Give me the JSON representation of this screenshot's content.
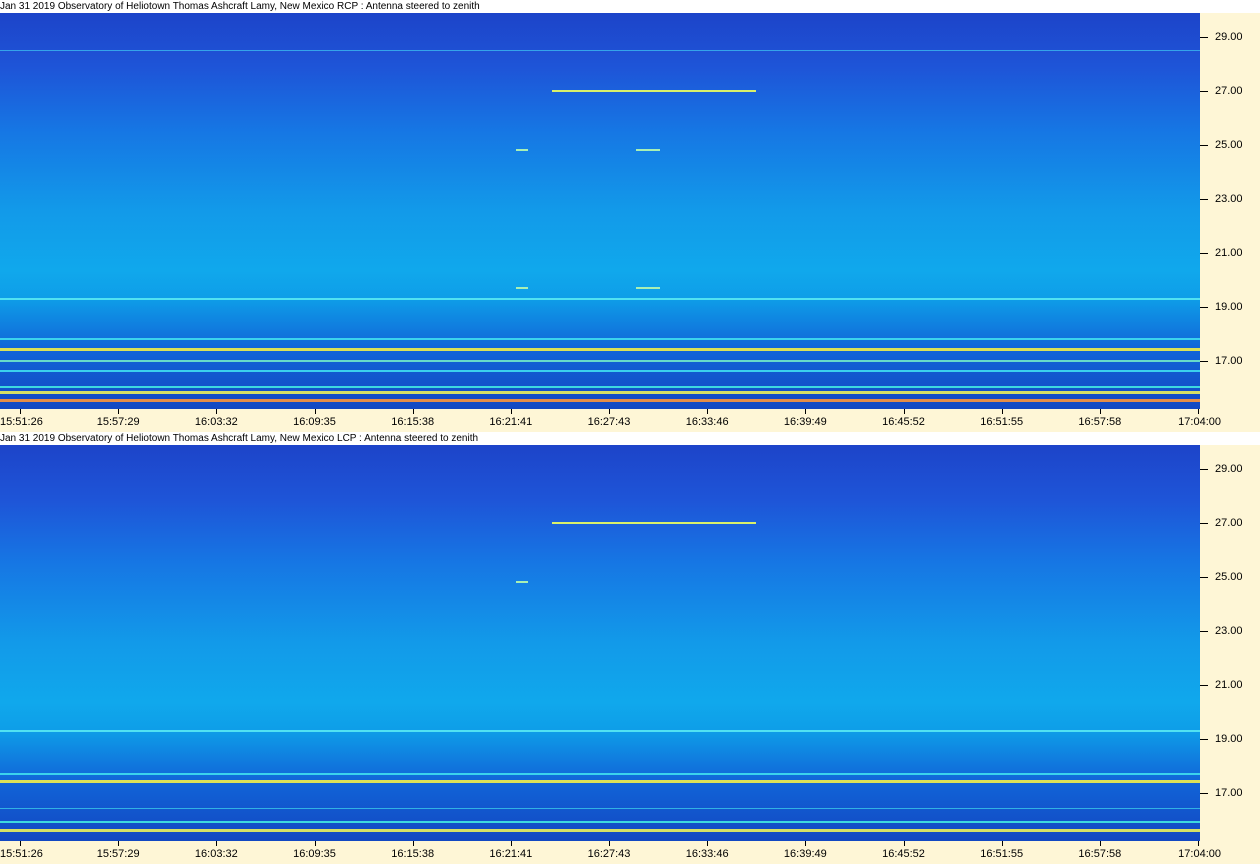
{
  "chart_data": [
    {
      "type": "heatmap",
      "title": "Jan 31 2019 Observatory of Heliotown  Thomas Ashcraft  Lamy, New Mexico  RCP  :  Antenna steered to zenith",
      "x_ticks": [
        "15:51:26",
        "15:57:29",
        "16:03:32",
        "16:09:35",
        "16:15:38",
        "16:21:41",
        "16:27:43",
        "16:33:46",
        "16:39:49",
        "16:45:52",
        "16:51:55",
        "16:57:58",
        "17:04:00"
      ],
      "y_ticks": [
        "29.00",
        "27.00",
        "25.00",
        "23.00",
        "21.00",
        "19.00",
        "17.00"
      ],
      "ylim": [
        15.2,
        29.9
      ],
      "features": [
        {
          "kind": "narrowband",
          "freq": 28.5,
          "color": "#3fc8f4",
          "weight": "faint"
        },
        {
          "kind": "burst",
          "freq": 27.0,
          "t_start": 0.46,
          "t_end": 0.63,
          "color": "#d8f06a"
        },
        {
          "kind": "burst",
          "freq": 24.8,
          "t_start": 0.43,
          "t_end": 0.44,
          "color": "#a8f0b4"
        },
        {
          "kind": "burst",
          "freq": 24.8,
          "t_start": 0.53,
          "t_end": 0.55,
          "color": "#a8f0b4"
        },
        {
          "kind": "burst",
          "freq": 19.7,
          "t_start": 0.43,
          "t_end": 0.44,
          "color": "#a8f0b4"
        },
        {
          "kind": "burst",
          "freq": 19.7,
          "t_start": 0.53,
          "t_end": 0.55,
          "color": "#a8f0b4"
        },
        {
          "kind": "narrowband",
          "freq": 19.3,
          "color": "#55e6f2",
          "weight": "medium"
        },
        {
          "kind": "narrowband",
          "freq": 17.8,
          "color": "#3ed8ee",
          "weight": "medium"
        },
        {
          "kind": "narrowband",
          "freq": 17.4,
          "color": "#e8e850",
          "weight": "strong"
        },
        {
          "kind": "narrowband",
          "freq": 17.0,
          "color": "#6de0c8",
          "weight": "medium"
        },
        {
          "kind": "narrowband",
          "freq": 16.6,
          "color": "#3ed8ee",
          "weight": "medium"
        },
        {
          "kind": "narrowband",
          "freq": 16.0,
          "color": "#40e0e0",
          "weight": "medium"
        },
        {
          "kind": "narrowband",
          "freq": 15.8,
          "color": "#e0e860",
          "weight": "strong"
        },
        {
          "kind": "narrowband",
          "freq": 15.5,
          "color": "#f09040",
          "weight": "strong"
        }
      ]
    },
    {
      "type": "heatmap",
      "title": "Jan 31 2019 Observatory of Heliotown  Thomas Ashcraft  Lamy, New Mexico  LCP  :  Antenna steered to zenith",
      "x_ticks": [
        "15:51:26",
        "15:57:29",
        "16:03:32",
        "16:09:35",
        "16:15:38",
        "16:21:41",
        "16:27:43",
        "16:33:46",
        "16:39:49",
        "16:45:52",
        "16:51:55",
        "16:57:58",
        "17:04:00"
      ],
      "y_ticks": [
        "29.00",
        "27.00",
        "25.00",
        "23.00",
        "21.00",
        "19.00",
        "17.00"
      ],
      "ylim": [
        15.2,
        29.9
      ],
      "features": [
        {
          "kind": "burst",
          "freq": 27.0,
          "t_start": 0.46,
          "t_end": 0.63,
          "color": "#d8f06a"
        },
        {
          "kind": "burst",
          "freq": 24.8,
          "t_start": 0.43,
          "t_end": 0.44,
          "color": "#a8f0b4"
        },
        {
          "kind": "narrowband",
          "freq": 19.3,
          "color": "#55e6f2",
          "weight": "medium"
        },
        {
          "kind": "narrowband",
          "freq": 17.7,
          "color": "#3ed8ee",
          "weight": "medium"
        },
        {
          "kind": "narrowband",
          "freq": 17.4,
          "color": "#e8e850",
          "weight": "strong"
        },
        {
          "kind": "narrowband",
          "freq": 16.4,
          "color": "#3ed8ee",
          "weight": "faint"
        },
        {
          "kind": "narrowband",
          "freq": 15.9,
          "color": "#40e0e0",
          "weight": "medium"
        },
        {
          "kind": "narrowband",
          "freq": 15.6,
          "color": "#e0e860",
          "weight": "strong"
        }
      ]
    }
  ]
}
